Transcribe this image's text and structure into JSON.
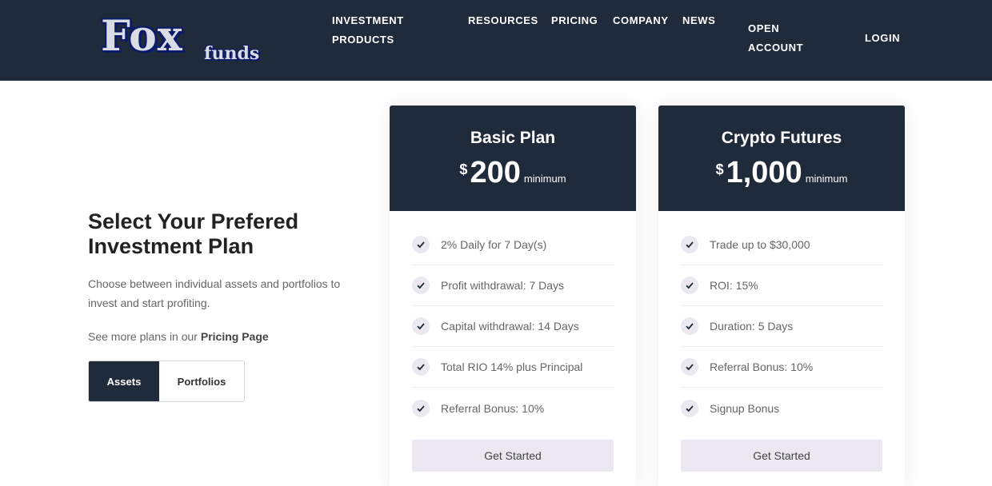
{
  "brand": {
    "logo_main": "Fox",
    "logo_sub": "funds"
  },
  "nav": {
    "investment_products": "INVESTMENT PRODUCTS",
    "resources": "RESOURCES",
    "pricing": "PRICING",
    "company": "COMPANY",
    "news": "NEWS",
    "open_account": "OPEN ACCOUNT",
    "login": "LOGIN"
  },
  "intro": {
    "headline": "Select Your Prefered Investment Plan",
    "description": "Choose between individual assets and portfolios to invest and start profiting.",
    "more_prefix": "See more plans in our ",
    "more_link": "Pricing Page",
    "toggle": {
      "assets": "Assets",
      "portfolios": "Portfolios",
      "selected": "Assets"
    }
  },
  "plans": [
    {
      "name": "Basic Plan",
      "currency": "$",
      "amount": "200",
      "suffix": "minimum",
      "features": [
        "2% Daily for 7 Day(s)",
        "Profit withdrawal: 7 Days",
        "Capital withdrawal: 14 Days",
        "Total RIO 14% plus Principal",
        "Referral Bonus: 10%"
      ],
      "cta": "Get Started"
    },
    {
      "name": "Crypto Futures",
      "currency": "$",
      "amount": "1,000",
      "suffix": "minimum",
      "features": [
        "Trade up to $30,000",
        "ROI: 15%",
        "Duration: 5 Days",
        "Referral Bonus: 10%",
        "Signup Bonus"
      ],
      "cta": "Get Started"
    }
  ],
  "colors": {
    "header_bg": "#1f2b3a",
    "accent_light": "#ece8f2",
    "logo_outline": "#0c1a6b"
  }
}
